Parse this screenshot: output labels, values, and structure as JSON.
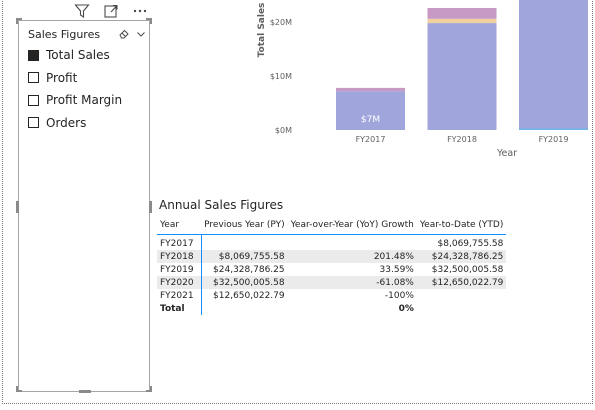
{
  "slicer": {
    "title": "Sales Figures",
    "items": [
      {
        "label": "Total Sales",
        "checked": true
      },
      {
        "label": "Profit",
        "checked": false
      },
      {
        "label": "Profit Margin",
        "checked": false
      },
      {
        "label": "Orders",
        "checked": false
      }
    ]
  },
  "chart_data": {
    "type": "bar",
    "stacked": true,
    "categories": [
      "FY2017",
      "FY2018",
      "FY2019"
    ],
    "series": [
      {
        "values": [
          7.2,
          19.8,
          31.8
        ],
        "color": "#a0a6dc"
      },
      {
        "values": [
          0,
          0.8,
          0
        ],
        "color": "#f0cfa0"
      },
      {
        "values": [
          0.6,
          2.0,
          0
        ],
        "color": "#c79ac6"
      }
    ],
    "data_labels": [
      "$7M",
      "",
      ""
    ],
    "xlabel": "Year",
    "ylabel": "Total Sales",
    "yticks": [
      "$0M",
      "$10M",
      "$20M"
    ],
    "tick_values": [
      0,
      10,
      20
    ],
    "ylim": [
      0,
      25
    ],
    "grid": false
  },
  "table": {
    "title": "Annual Sales Figures",
    "columns": [
      "Year",
      "Previous Year (PY)",
      "Year-over-Year (YoY) Growth",
      "Year-to-Date (YTD)"
    ],
    "rows": [
      [
        "FY2017",
        "",
        "",
        "$8,069,755.58"
      ],
      [
        "FY2018",
        "$8,069,755.58",
        "201.48%",
        "$24,328,786.25"
      ],
      [
        "FY2019",
        "$24,328,786.25",
        "33.59%",
        "$32,500,005.58"
      ],
      [
        "FY2020",
        "$32,500,005.58",
        "-61.08%",
        "$12,650,022.79"
      ],
      [
        "FY2021",
        "$12,650,022.79",
        "-100%",
        ""
      ]
    ],
    "total": [
      "Total",
      "",
      "0%",
      ""
    ]
  }
}
